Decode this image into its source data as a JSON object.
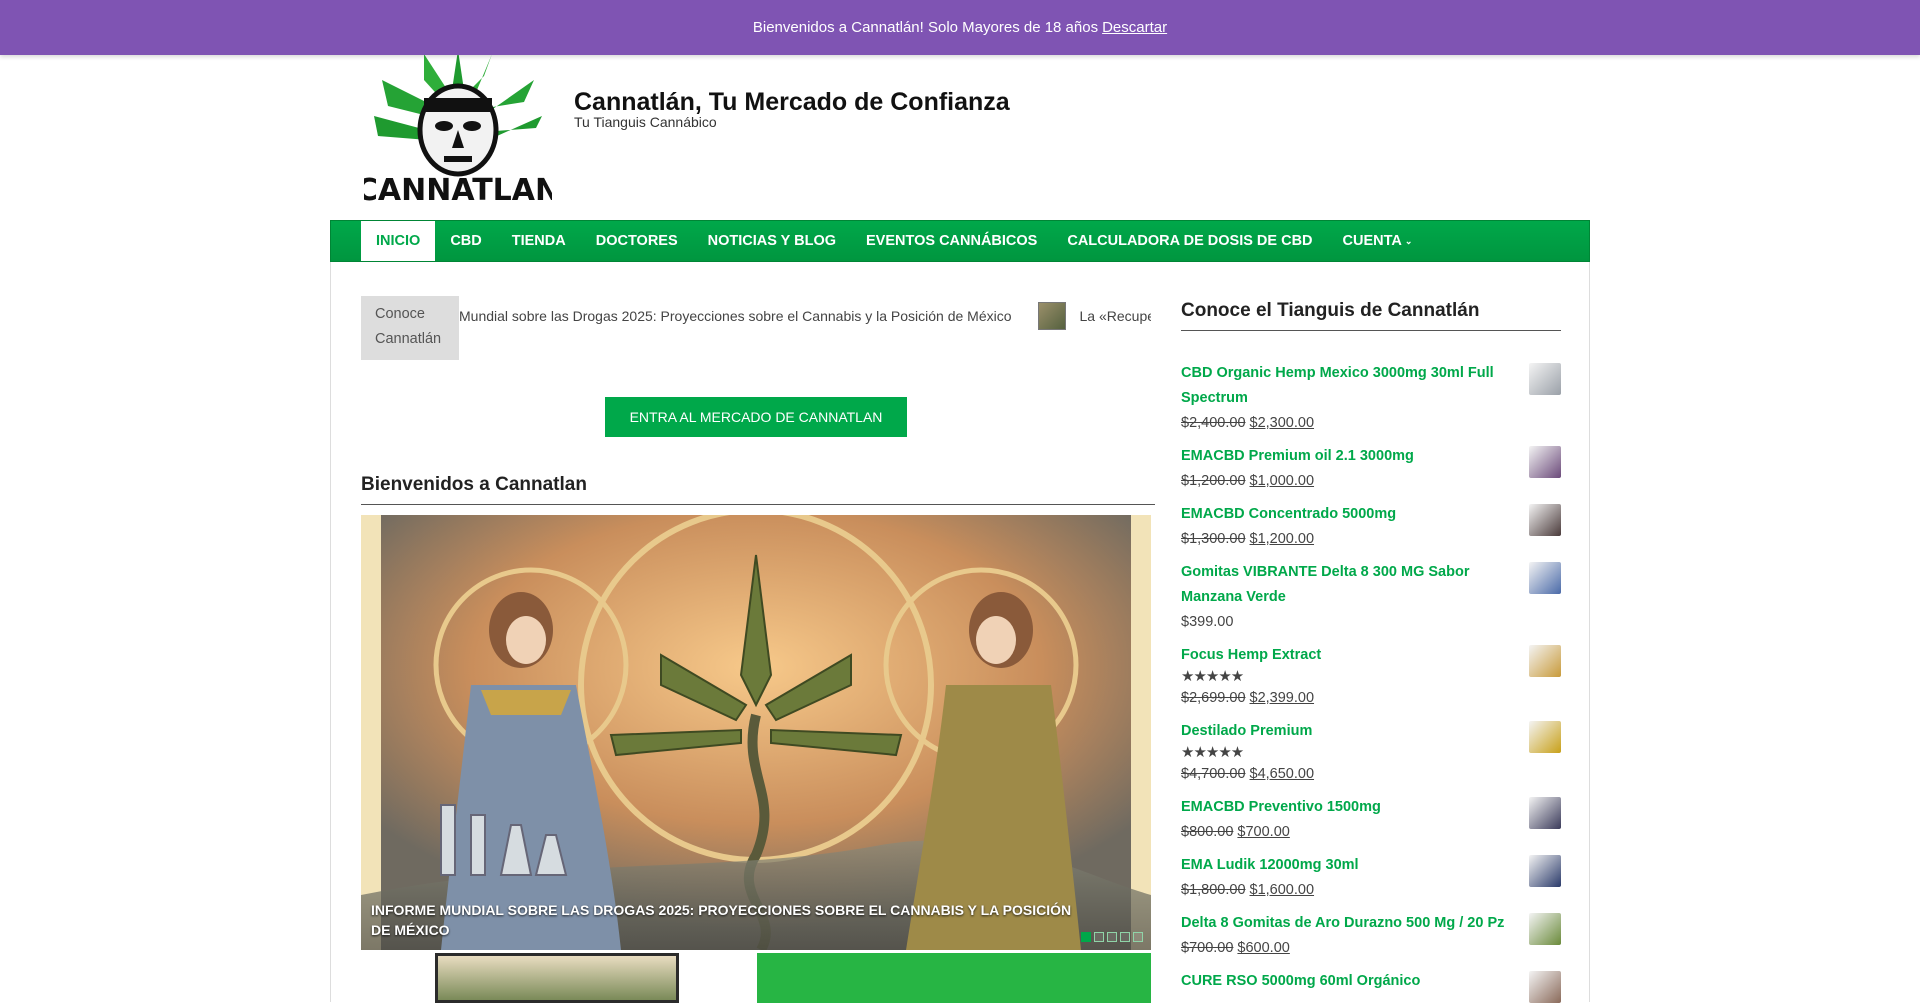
{
  "notice": {
    "text": "Bienvenidos a Cannatlán! Solo Mayores de 18 años",
    "dismiss": "Descartar"
  },
  "site": {
    "title": "Cannatlán, Tu Mercado de Confianza",
    "tagline": "Tu Tianguis Cannábico",
    "logo_text": "CANNATLAN"
  },
  "nav": {
    "items": [
      {
        "label": "Inicio"
      },
      {
        "label": "CBD"
      },
      {
        "label": "Tienda"
      },
      {
        "label": "Doctores"
      },
      {
        "label": "Noticias y Blog"
      },
      {
        "label": "Eventos Cannábicos"
      },
      {
        "label": "Calculadora de Dosis de CBD"
      },
      {
        "label": "Cuenta"
      }
    ]
  },
  "ticker": {
    "label": "Conoce Cannatlán",
    "item1": "Mundial sobre las Drogas 2025: Proyecciones sobre el Cannabis y la Posición de México",
    "item2": "La «Recupe"
  },
  "cta": {
    "label": "ENTRA AL MERCADO DE CANNATLAN"
  },
  "main": {
    "title": "Bienvenidos a Cannatlan"
  },
  "slider": {
    "caption": "INFORME MUNDIAL SOBRE LAS DROGAS 2025: PROYECCIONES SOBRE EL CANNABIS Y LA POSICIÓN DE MÉXICO",
    "active_index": 0,
    "count": 5
  },
  "sidebar": {
    "title": "Conoce el Tianguis de Cannatlán",
    "products": [
      {
        "name": "CBD Organic Hemp Mexico 3000mg 30ml Full Spectrum",
        "old": "$2,400.00",
        "price": "$2,300.00",
        "rating": null,
        "thumb_color": "#9aa0a8"
      },
      {
        "name": "EMACBD Premium oil 2.1 3000mg",
        "old": "$1,200.00",
        "price": "$1,000.00",
        "rating": null,
        "thumb_color": "#6b4a7a"
      },
      {
        "name": "EMACBD Concentrado 5000mg",
        "old": "$1,300.00",
        "price": "$1,200.00",
        "rating": null,
        "thumb_color": "#4a3a3a"
      },
      {
        "name": "Gomitas VIBRANTE Delta 8 300 MG Sabor Manzana Verde",
        "old": "",
        "price": "$399.00",
        "rating": null,
        "thumb_color": "#4a6aa8"
      },
      {
        "name": "Focus Hemp Extract",
        "old": "$2,699.00",
        "price": "$2,399.00",
        "rating": "★★★★★",
        "thumb_color": "#c89a3a"
      },
      {
        "name": "Destilado Premium",
        "old": "$4,700.00",
        "price": "$4,650.00",
        "rating": "★★★★★",
        "thumb_color": "#c8a018"
      },
      {
        "name": "EMACBD Preventivo 1500mg",
        "old": "$800.00",
        "price": "$700.00",
        "rating": null,
        "thumb_color": "#3a3a5a"
      },
      {
        "name": "EMA Ludik 12000mg 30ml",
        "old": "$1,800.00",
        "price": "$1,600.00",
        "rating": null,
        "thumb_color": "#2a3a6a"
      },
      {
        "name": "Delta 8 Gomitas de Aro Durazno 500 Mg / 20 Pz",
        "old": "$700.00",
        "price": "$600.00",
        "rating": null,
        "thumb_color": "#6a8a3a"
      },
      {
        "name": "CURE RSO 5000mg 60ml Orgánico",
        "old": "",
        "price": "",
        "rating": null,
        "thumb_color": "#8a6a5a"
      }
    ]
  },
  "colors": {
    "accent": "#00a84a",
    "notice_bg": "#7f54b3"
  }
}
